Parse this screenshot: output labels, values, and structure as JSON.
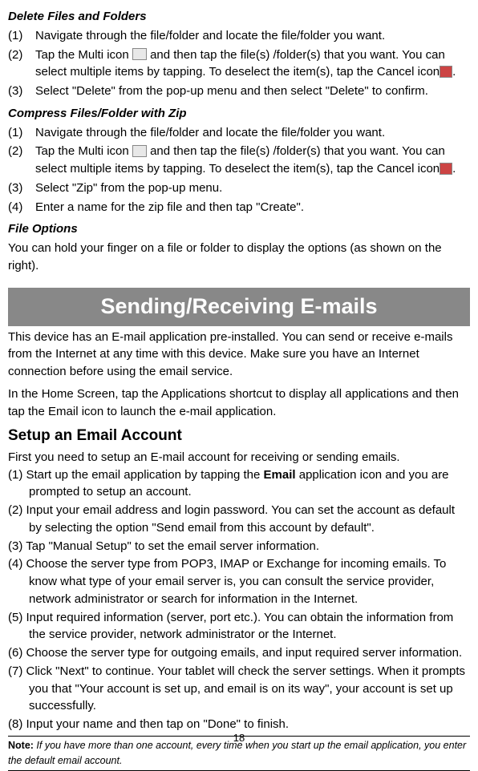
{
  "delete_section": {
    "title": "Delete Files and Folders",
    "steps": [
      {
        "num": "(1)",
        "text": "Navigate through the file/folder and locate the file/folder you want."
      },
      {
        "num": "(2)",
        "text_a": "Tap the Multi icon ",
        "text_b": " and then tap the file(s) /folder(s) that you want. You can select multiple items by tapping. To deselect the item(s), tap the Cancel icon",
        "text_c": "."
      },
      {
        "num": "(3)",
        "text": "Select \"Delete\" from the pop-up menu and then select \"Delete\" to confirm."
      }
    ]
  },
  "compress_section": {
    "title": "Compress Files/Folder with Zip",
    "steps": [
      {
        "num": "(1)",
        "text": "Navigate through the file/folder and locate the file/folder you want."
      },
      {
        "num": "(2)",
        "text_a": "Tap the Multi icon ",
        "text_b": " and then tap the file(s) /folder(s) that you want. You can select multiple items by tapping. To deselect the item(s), tap the Cancel icon",
        "text_c": "."
      },
      {
        "num": "(3)",
        "text": "Select \"Zip\" from the pop-up menu."
      },
      {
        "num": "(4)",
        "text": "Enter a name for the zip file and then tap \"Create\"."
      }
    ]
  },
  "file_options": {
    "title": "File Options",
    "text": "You can hold your finger on a file or folder to display the options (as shown on the right)."
  },
  "email_banner": "Sending/Receiving E-mails",
  "email_intro1": "This device has an E-mail application pre-installed. You can send or receive e-mails from the Internet at any time with this device. Make sure you have an Internet connection before using the email service.",
  "email_intro2": "In the Home Screen, tap the Applications shortcut to display all applications and then tap the Email icon to launch the e-mail application.",
  "setup_section": {
    "title": "Setup an Email Account",
    "intro": "First you need to setup an E-mail account for receiving or sending emails.",
    "steps": {
      "s1a": "(1) Start up the email application by tapping the ",
      "s1bold": "Email",
      "s1b": " application icon and you are prompted to setup an account.",
      "s2": "(2) Input your email address and login password. You can set the account as default by selecting the option \"Send email from this account by default\".",
      "s3": "(3) Tap \"Manual Setup\" to set the email server information.",
      "s4": "(4) Choose the server type from POP3, IMAP or Exchange for incoming emails. To know what type of your email server is, you can consult the service provider, network administrator or search for information in the Internet.",
      "s5": "(5) Input required information (server, port etc.). You can obtain the information from the service provider, network administrator or the Internet.",
      "s6": "(6) Choose the server type for outgoing emails, and input required server information.",
      "s7": "(7) Click \"Next\" to continue. Your tablet will check the server settings. When it prompts you that \"Your account is set up, and email is on its way\", your account is set up successfully.",
      "s8": "(8) Input your name and then tap on \"Done\" to finish."
    }
  },
  "note": {
    "label": "Note:",
    "text": " If you have more than one account, every time when you start up the email application, you enter the default email account."
  },
  "page_number": "18"
}
